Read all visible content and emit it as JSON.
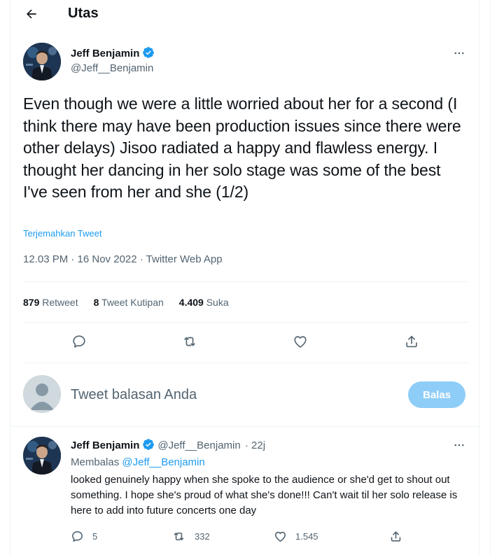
{
  "header": {
    "title": "Utas"
  },
  "main_tweet": {
    "author_name": "Jeff Benjamin",
    "author_handle": "@Jeff__Benjamin",
    "text": "Even though we were a little worried about her for a second (I think there may have been production issues since there were other delays) Jisoo radiated a happy and flawless energy. I thought her dancing in her solo stage was some of the best I've seen from her and she (1/2)",
    "translate_label": "Terjemahkan Tweet",
    "meta": "12.03 PM · 16 Nov 2022 · Twitter Web App",
    "stats": {
      "retweets_count": "879",
      "retweets_label": "Retweet",
      "quotes_count": "8",
      "quotes_label": "Tweet Kutipan",
      "likes_count": "4.409",
      "likes_label": "Suka"
    }
  },
  "composer": {
    "placeholder": "Tweet balasan Anda",
    "button_label": "Balas"
  },
  "reply_tweet": {
    "author_name": "Jeff Benjamin",
    "author_handle": "@Jeff__Benjamin",
    "time": "· 22j",
    "replying_prefix": "Membalas",
    "replying_to": "@Jeff__Benjamin",
    "text": "looked genuinely happy when she spoke to the audience or she'd get to shout out something. I hope she's proud of what she's done!!! Can't wait til her solo release is here to add into future concerts one day",
    "reply_count": "5",
    "retweet_count": "332",
    "like_count": "1.545"
  },
  "colors": {
    "accent": "#1d9bf0",
    "button_disabled": "#8ecdf8",
    "secondary_text": "#536471",
    "divider": "#eff3f4"
  },
  "icons": [
    "back-arrow-icon",
    "verified-badge-icon",
    "more-icon",
    "reply-icon",
    "retweet-icon",
    "like-icon",
    "share-icon",
    "default-avatar-icon"
  ]
}
